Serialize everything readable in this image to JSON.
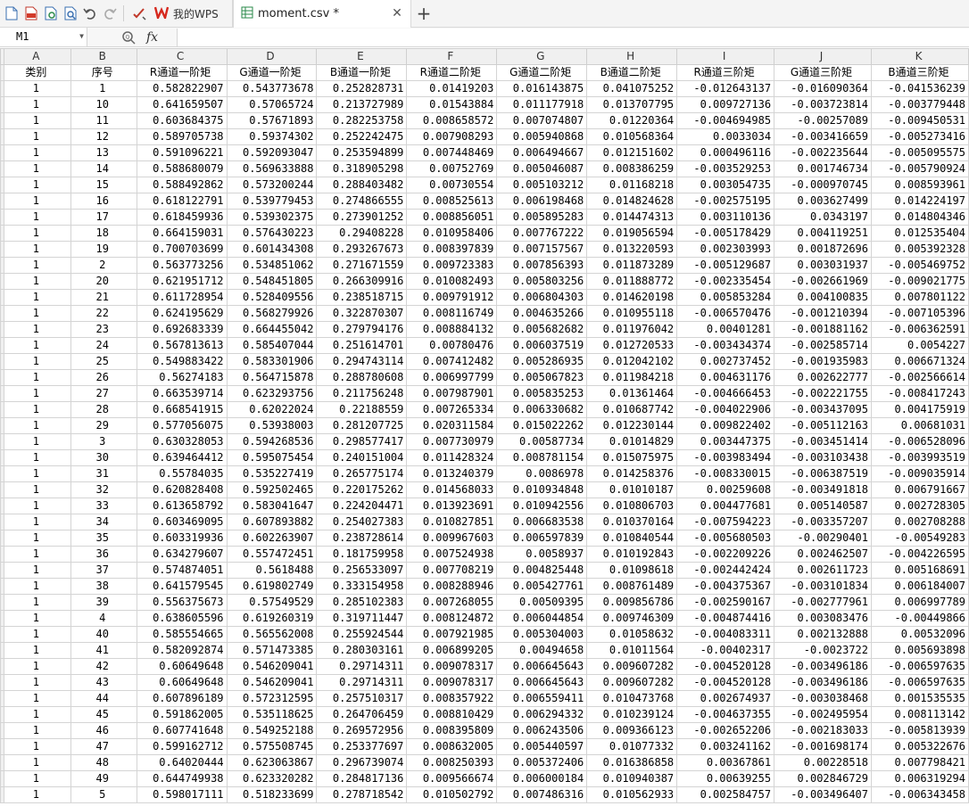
{
  "toolbar": {
    "icons": [
      "new-file-icon",
      "pdf-icon",
      "print-preview-icon",
      "preview-icon",
      "undo-icon",
      "redo-icon",
      "format-painter-icon"
    ]
  },
  "tabs": [
    {
      "label": "我的WPS",
      "icon": "wps-logo-icon"
    },
    {
      "label": "moment.csv *",
      "icon": "spreadsheet-icon"
    }
  ],
  "formula_bar": {
    "cell_ref": "M1",
    "fx": "fx",
    "value": ""
  },
  "columns": [
    "A",
    "B",
    "C",
    "D",
    "E",
    "F",
    "G",
    "H",
    "I",
    "J",
    "K"
  ],
  "header_row": [
    "类别",
    "序号",
    "R通道一阶矩",
    "G通道一阶矩",
    "B通道一阶矩",
    "R通道二阶矩",
    "G通道二阶矩",
    "B通道二阶矩",
    "R通道三阶矩",
    "G通道三阶矩",
    "B通道三阶矩"
  ],
  "rows": [
    [
      "1",
      "1",
      "0.582822907",
      "0.543773678",
      "0.252828731",
      "0.01419203",
      "0.016143875",
      "0.041075252",
      "-0.012643137",
      "-0.016090364",
      "-0.041536239"
    ],
    [
      "1",
      "10",
      "0.641659507",
      "0.57065724",
      "0.213727989",
      "0.01543884",
      "0.011177918",
      "0.013707795",
      "0.009727136",
      "-0.003723814",
      "-0.003779448"
    ],
    [
      "1",
      "11",
      "0.603684375",
      "0.57671893",
      "0.282253758",
      "0.008658572",
      "0.007074807",
      "0.01220364",
      "-0.004694985",
      "-0.00257089",
      "-0.009450531"
    ],
    [
      "1",
      "12",
      "0.589705738",
      "0.59374302",
      "0.252242475",
      "0.007908293",
      "0.005940868",
      "0.010568364",
      "0.0033034",
      "-0.003416659",
      "-0.005273416"
    ],
    [
      "1",
      "13",
      "0.591096221",
      "0.592093047",
      "0.253594899",
      "0.007448469",
      "0.006494667",
      "0.012151602",
      "0.000496116",
      "-0.002235644",
      "-0.005095575"
    ],
    [
      "1",
      "14",
      "0.588680079",
      "0.569633888",
      "0.318905298",
      "0.00752769",
      "0.005046087",
      "0.008386259",
      "-0.003529253",
      "0.001746734",
      "-0.005790924"
    ],
    [
      "1",
      "15",
      "0.588492862",
      "0.573200244",
      "0.288403482",
      "0.00730554",
      "0.005103212",
      "0.01168218",
      "0.003054735",
      "-0.000970745",
      "0.008593961"
    ],
    [
      "1",
      "16",
      "0.618122791",
      "0.539779453",
      "0.274866555",
      "0.008525613",
      "0.006198468",
      "0.014824628",
      "-0.002575195",
      "0.003627499",
      "0.014224197"
    ],
    [
      "1",
      "17",
      "0.618459936",
      "0.539302375",
      "0.273901252",
      "0.008856051",
      "0.005895283",
      "0.014474313",
      "0.003110136",
      "0.0343197",
      "0.014804346"
    ],
    [
      "1",
      "18",
      "0.664159031",
      "0.576430223",
      "0.29408228",
      "0.010958406",
      "0.007767222",
      "0.019056594",
      "-0.005178429",
      "0.004119251",
      "0.012535404"
    ],
    [
      "1",
      "19",
      "0.700703699",
      "0.601434308",
      "0.293267673",
      "0.008397839",
      "0.007157567",
      "0.013220593",
      "0.002303993",
      "0.001872696",
      "0.005392328"
    ],
    [
      "1",
      "2",
      "0.563773256",
      "0.534851062",
      "0.271671559",
      "0.009723383",
      "0.007856393",
      "0.011873289",
      "-0.005129687",
      "0.003031937",
      "-0.005469752"
    ],
    [
      "1",
      "20",
      "0.621951712",
      "0.548451805",
      "0.266309916",
      "0.010082493",
      "0.005803256",
      "0.011888772",
      "-0.002335454",
      "-0.002661969",
      "-0.009021775"
    ],
    [
      "1",
      "21",
      "0.611728954",
      "0.528409556",
      "0.238518715",
      "0.009791912",
      "0.006804303",
      "0.014620198",
      "0.005853284",
      "0.004100835",
      "0.007801122"
    ],
    [
      "1",
      "22",
      "0.624195629",
      "0.568279926",
      "0.322870307",
      "0.008116749",
      "0.004635266",
      "0.010955118",
      "-0.006570476",
      "-0.001210394",
      "-0.007105396"
    ],
    [
      "1",
      "23",
      "0.692683339",
      "0.664455042",
      "0.279794176",
      "0.008884132",
      "0.005682682",
      "0.011976042",
      "0.00401281",
      "-0.001881162",
      "-0.006362591"
    ],
    [
      "1",
      "24",
      "0.567813613",
      "0.585407044",
      "0.251614701",
      "0.00780476",
      "0.006037519",
      "0.012720533",
      "-0.003434374",
      "-0.002585714",
      "0.0054227"
    ],
    [
      "1",
      "25",
      "0.549883422",
      "0.583301906",
      "0.294743114",
      "0.007412482",
      "0.005286935",
      "0.012042102",
      "0.002737452",
      "-0.001935983",
      "0.006671324"
    ],
    [
      "1",
      "26",
      "0.56274183",
      "0.564715878",
      "0.288780608",
      "0.006997799",
      "0.005067823",
      "0.011984218",
      "0.004631176",
      "0.002622777",
      "-0.002566614"
    ],
    [
      "1",
      "27",
      "0.663539714",
      "0.623293756",
      "0.211756248",
      "0.007987901",
      "0.005835253",
      "0.01361464",
      "-0.004666453",
      "-0.002221755",
      "-0.008417243"
    ],
    [
      "1",
      "28",
      "0.668541915",
      "0.62022024",
      "0.22188559",
      "0.007265334",
      "0.006330682",
      "0.010687742",
      "-0.004022906",
      "-0.003437095",
      "0.004175919"
    ],
    [
      "1",
      "29",
      "0.577056075",
      "0.53938003",
      "0.281207725",
      "0.020311584",
      "0.015022262",
      "0.012230144",
      "0.009822402",
      "-0.005112163",
      "0.00681031"
    ],
    [
      "1",
      "3",
      "0.630328053",
      "0.594268536",
      "0.298577417",
      "0.007730979",
      "0.00587734",
      "0.01014829",
      "0.003447375",
      "-0.003451414",
      "-0.006528096"
    ],
    [
      "1",
      "30",
      "0.639464412",
      "0.595075454",
      "0.240151004",
      "0.011428324",
      "0.008781154",
      "0.015075975",
      "-0.003983494",
      "-0.003103438",
      "-0.003993519"
    ],
    [
      "1",
      "31",
      "0.55784035",
      "0.535227419",
      "0.265775174",
      "0.013240379",
      "0.0086978",
      "0.014258376",
      "-0.008330015",
      "-0.006387519",
      "-0.009035914"
    ],
    [
      "1",
      "32",
      "0.620828408",
      "0.592502465",
      "0.220175262",
      "0.014568033",
      "0.010934848",
      "0.01010187",
      "0.00259608",
      "-0.003491818",
      "0.006791667"
    ],
    [
      "1",
      "33",
      "0.613658792",
      "0.583041647",
      "0.224204471",
      "0.013923691",
      "0.010942556",
      "0.010806703",
      "0.004477681",
      "0.005140587",
      "0.002728305"
    ],
    [
      "1",
      "34",
      "0.603469095",
      "0.607893882",
      "0.254027383",
      "0.010827851",
      "0.006683538",
      "0.010370164",
      "-0.007594223",
      "-0.003357207",
      "0.002708288"
    ],
    [
      "1",
      "35",
      "0.603319936",
      "0.602263907",
      "0.238728614",
      "0.009967603",
      "0.006597839",
      "0.010840544",
      "-0.005680503",
      "-0.00290401",
      "-0.00549283"
    ],
    [
      "1",
      "36",
      "0.634279607",
      "0.557472451",
      "0.181759958",
      "0.007524938",
      "0.0058937",
      "0.010192843",
      "-0.002209226",
      "0.002462507",
      "-0.004226595"
    ],
    [
      "1",
      "37",
      "0.574874051",
      "0.5618488",
      "0.256533097",
      "0.007708219",
      "0.004825448",
      "0.01098618",
      "-0.002442424",
      "0.002611723",
      "0.005168691"
    ],
    [
      "1",
      "38",
      "0.641579545",
      "0.619802749",
      "0.333154958",
      "0.008288946",
      "0.005427761",
      "0.008761489",
      "-0.004375367",
      "-0.003101834",
      "0.006184007"
    ],
    [
      "1",
      "39",
      "0.556375673",
      "0.57549529",
      "0.285102383",
      "0.007268055",
      "0.00509395",
      "0.009856786",
      "-0.002590167",
      "-0.002777961",
      "0.006997789"
    ],
    [
      "1",
      "4",
      "0.638605596",
      "0.619260319",
      "0.319711447",
      "0.008124872",
      "0.006044854",
      "0.009746309",
      "-0.004874416",
      "0.003083476",
      "-0.00449866"
    ],
    [
      "1",
      "40",
      "0.585554665",
      "0.565562008",
      "0.255924544",
      "0.007921985",
      "0.005304003",
      "0.01058632",
      "-0.004083311",
      "0.002132888",
      "0.00532096"
    ],
    [
      "1",
      "41",
      "0.582092874",
      "0.571473385",
      "0.280303161",
      "0.006899205",
      "0.00494658",
      "0.01011564",
      "-0.00402317",
      "-0.0023722",
      "0.005693898"
    ],
    [
      "1",
      "42",
      "0.60649648",
      "0.546209041",
      "0.29714311",
      "0.009078317",
      "0.006645643",
      "0.009607282",
      "-0.004520128",
      "-0.003496186",
      "-0.006597635"
    ],
    [
      "1",
      "43",
      "0.60649648",
      "0.546209041",
      "0.29714311",
      "0.009078317",
      "0.006645643",
      "0.009607282",
      "-0.004520128",
      "-0.003496186",
      "-0.006597635"
    ],
    [
      "1",
      "44",
      "0.607896189",
      "0.572312595",
      "0.257510317",
      "0.008357922",
      "0.006559411",
      "0.010473768",
      "0.002674937",
      "-0.003038468",
      "0.001535535"
    ],
    [
      "1",
      "45",
      "0.591862005",
      "0.535118625",
      "0.264706459",
      "0.008810429",
      "0.006294332",
      "0.010239124",
      "-0.004637355",
      "-0.002495954",
      "0.008113142"
    ],
    [
      "1",
      "46",
      "0.607741648",
      "0.549252188",
      "0.269572956",
      "0.008395809",
      "0.006243506",
      "0.009366123",
      "-0.002652206",
      "-0.002183033",
      "-0.005813939"
    ],
    [
      "1",
      "47",
      "0.599162712",
      "0.575508745",
      "0.253377697",
      "0.008632005",
      "0.005440597",
      "0.01077332",
      "0.003241162",
      "-0.001698174",
      "0.005322676"
    ],
    [
      "1",
      "48",
      "0.64020444",
      "0.623063867",
      "0.296739074",
      "0.008250393",
      "0.005372406",
      "0.016386858",
      "0.00367861",
      "0.00228518",
      "0.007798421"
    ],
    [
      "1",
      "49",
      "0.644749938",
      "0.623320282",
      "0.284817136",
      "0.009566674",
      "0.006000184",
      "0.010940387",
      "0.00639255",
      "0.002846729",
      "0.006319294"
    ],
    [
      "1",
      "5",
      "0.598017111",
      "0.518233699",
      "0.278718542",
      "0.010502792",
      "0.007486316",
      "0.010562933",
      "0.002584757",
      "-0.003496407",
      "-0.006343458"
    ]
  ]
}
